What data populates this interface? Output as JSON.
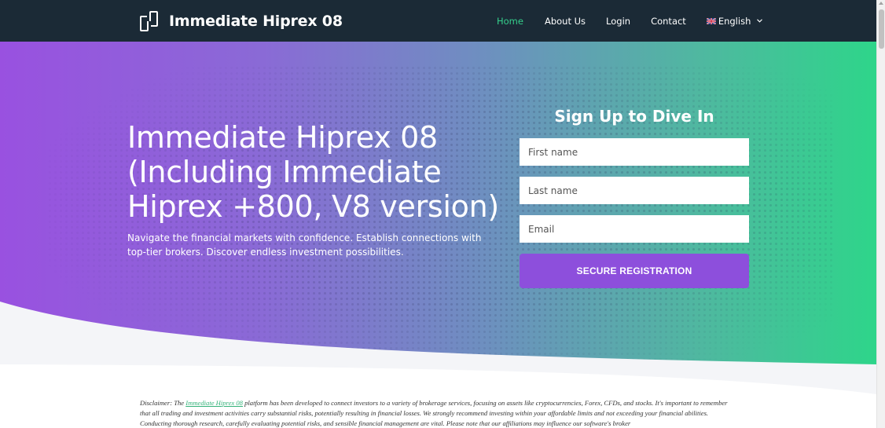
{
  "brand": {
    "name": "Immediate Hiprex 08"
  },
  "nav": {
    "home": "Home",
    "about": "About Us",
    "login": "Login",
    "contact": "Contact",
    "language": "English"
  },
  "hero": {
    "title": "Immediate Hiprex 08 (Including Immediate Hiprex +800, V8 version)",
    "subtitle": "Navigate the financial markets with confidence. Establish connections with top-tier brokers. Discover endless investment possibilities."
  },
  "form": {
    "title": "Sign Up to Dive In",
    "first_name_placeholder": "First name",
    "last_name_placeholder": "Last name",
    "email_placeholder": "Email",
    "submit_label": "SECURE REGISTRATION"
  },
  "disclaimer": {
    "prefix": "Disclaimer: The ",
    "link": "Immediate Hiprex 08",
    "text": " platform has been developed to connect investors to a variety of brokerage services, focusing on assets like cryptocurrencies, Forex, CFDs, and stocks. It's important to remember that all trading and investment activities carry substantial risks, potentially resulting in financial losses. We strongly recommend investing within your affordable limits and not exceeding your financial abilities. Conducting thorough research, carefully evaluating potential risks, and sensible financial management are vital. Please note that our affiliations may influence our software's broker"
  },
  "colors": {
    "navbar": "#1b2a36",
    "nav_active": "#35d08c",
    "gradient_start": "#9951e0",
    "gradient_end": "#2ed58a",
    "button": "#8d4fdc"
  },
  "icons": {
    "brand": "interlocking-squares-icon",
    "flag": "uk-flag-icon",
    "dropdown": "chevron-down-icon"
  }
}
